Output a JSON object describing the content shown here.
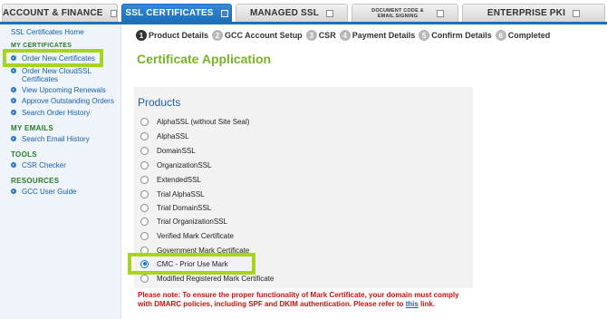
{
  "tabs": [
    {
      "label": "ACCOUNT & FINANCE",
      "active": false
    },
    {
      "label": "SSL CERTIFICATES",
      "active": true
    },
    {
      "label": "MANAGED SSL",
      "active": false
    },
    {
      "label": "DOCUMENT CODE & EMAIL SIGNING",
      "active": false
    },
    {
      "label": "ENTERPRISE PKI",
      "active": false
    }
  ],
  "sidebar": {
    "home": "SSL Certificates Home",
    "section1_heading": "MY CERTIFICATES",
    "items": [
      "Order New Certificates",
      "Order New CloudSSL Certificates",
      "View Upcoming Renewals",
      "Approve Outstanding Orders",
      "Search Order History"
    ],
    "emails_heading": "MY EMAILS",
    "emails_items": [
      "Search Email History"
    ],
    "tools_heading": "TOOLS",
    "tools_items": [
      "CSR Checker"
    ],
    "resources_heading": "RESOURCES",
    "resources_items": [
      "GCC User Guide"
    ]
  },
  "steps": [
    {
      "num": "1",
      "label": "Product Details",
      "current": true
    },
    {
      "num": "2",
      "label": "GCC Account Setup",
      "current": false
    },
    {
      "num": "3",
      "label": "CSR",
      "current": false
    },
    {
      "num": "4",
      "label": "Payment Details",
      "current": false
    },
    {
      "num": "5",
      "label": "Confirm Details",
      "current": false
    },
    {
      "num": "6",
      "label": "Completed",
      "current": false
    }
  ],
  "page_title": "Certificate Application",
  "products": {
    "title": "Products",
    "options": [
      "AlphaSSL (without Site Seal)",
      "AlphaSSL",
      "DomainSSL",
      "OrganizationSSL",
      "ExtendedSSL",
      "Trial AlphaSSL",
      "Trial DomainSSL",
      "Trial OrganizationSSL",
      "Verified Mark Certificate",
      "Government Mark Certificate",
      "CMC - Prior Use Mark",
      "Modified Registered Mark Certificate"
    ],
    "selected": "CMC - Prior Use Mark"
  },
  "note": {
    "text": "Please note: To ensure the proper functionality of Mark Certificate, your domain must comply with DMARC policies, including SPF and DKIM authentication. Please refer to ",
    "link": "this",
    "end": " link."
  },
  "colors": {
    "accent": "#1f6fb8",
    "highlight": "#a6d41f",
    "title": "#7ab22a",
    "note": "#cc1111"
  }
}
